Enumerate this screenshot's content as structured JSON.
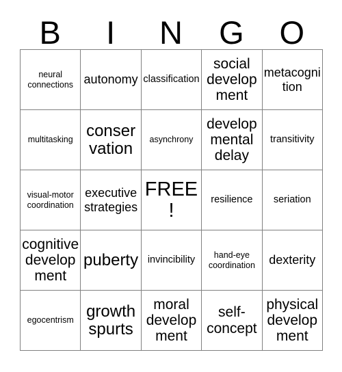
{
  "card": {
    "header_letters": [
      "B",
      "I",
      "N",
      "G",
      "O"
    ],
    "free_space_label": "FREE!",
    "border_color": "#808080",
    "text_color": "#000000",
    "background_color": "#ffffff",
    "rows": [
      [
        {
          "text": "neural connections",
          "size": "sz-xs"
        },
        {
          "text": "autonomy",
          "size": "sz-md"
        },
        {
          "text": "classification",
          "size": "sz-sm"
        },
        {
          "text": "social development",
          "size": "sz-lg"
        },
        {
          "text": "metacognition",
          "size": "sz-md"
        }
      ],
      [
        {
          "text": "multitasking",
          "size": "sz-xs"
        },
        {
          "text": "conservation",
          "size": "sz-xl"
        },
        {
          "text": "asynchrony",
          "size": "sz-xs"
        },
        {
          "text": "developmental delay",
          "size": "sz-lg"
        },
        {
          "text": "transitivity",
          "size": "sz-sm"
        }
      ],
      [
        {
          "text": "visual-motor coordination",
          "size": "sz-xs"
        },
        {
          "text": "executive strategies",
          "size": "sz-md"
        },
        {
          "text": "FREE!",
          "size": "sz-xxl"
        },
        {
          "text": "resilience",
          "size": "sz-sm"
        },
        {
          "text": "seriation",
          "size": "sz-sm"
        }
      ],
      [
        {
          "text": "cognitive development",
          "size": "sz-lg"
        },
        {
          "text": "puberty",
          "size": "sz-xl"
        },
        {
          "text": "invincibility",
          "size": "sz-sm"
        },
        {
          "text": "hand-eye coordination",
          "size": "sz-xs"
        },
        {
          "text": "dexterity",
          "size": "sz-md"
        }
      ],
      [
        {
          "text": "egocentrism",
          "size": "sz-xs"
        },
        {
          "text": "growth spurts",
          "size": "sz-xl"
        },
        {
          "text": "moral development",
          "size": "sz-lg"
        },
        {
          "text": "self-concept",
          "size": "sz-lg"
        },
        {
          "text": "physical development",
          "size": "sz-lg"
        }
      ]
    ]
  }
}
